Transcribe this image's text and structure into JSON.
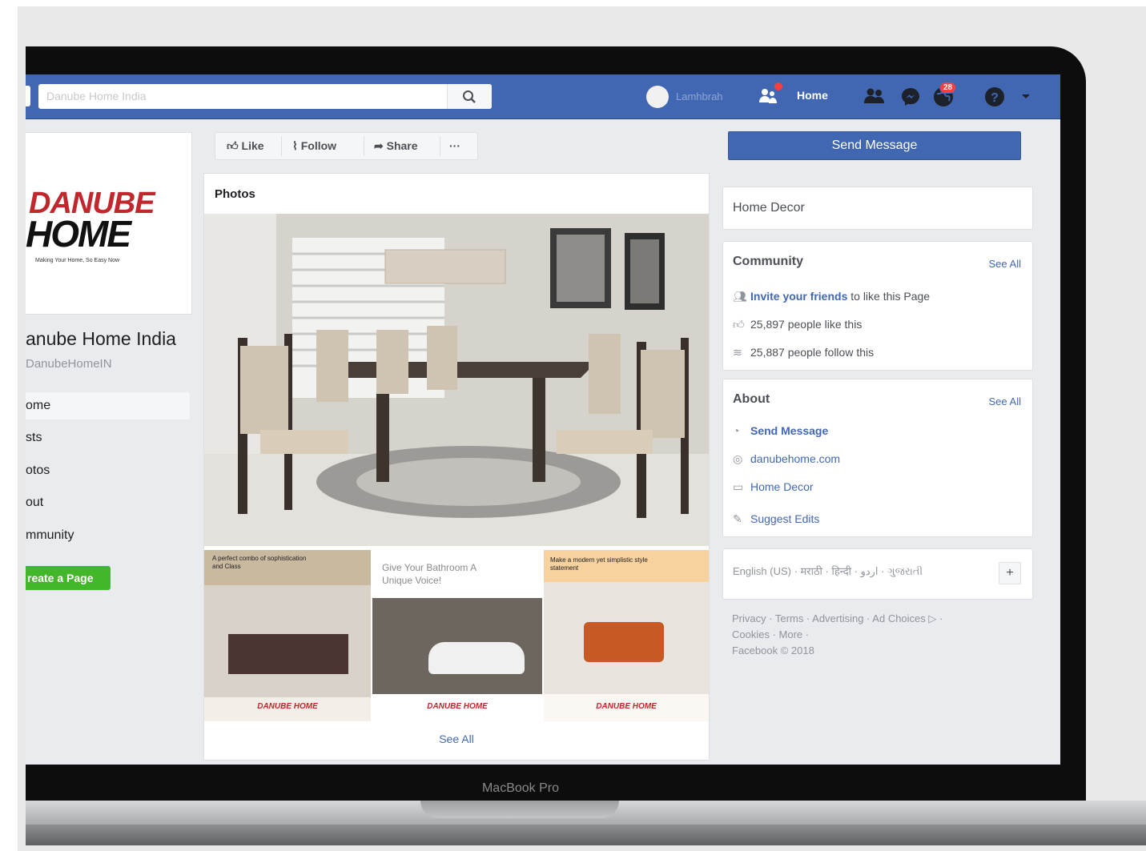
{
  "device": {
    "label": "MacBook Pro"
  },
  "topbar": {
    "search_value": "Danube Home India",
    "user_name": "Lamhbrah",
    "home_label": "Home",
    "notification_count": "28",
    "icons": [
      "search-icon",
      "friend-request-icon",
      "friends-icon",
      "messenger-icon",
      "globe-icon",
      "help-icon",
      "caret-down-icon"
    ]
  },
  "left": {
    "logo_line1": "DANUBE",
    "logo_line2": "HOME",
    "logo_tagline": "Making Your Home, So Easy Now",
    "page_name": "anube Home India",
    "page_username": "DanubeHomeIN",
    "nav": [
      "ome",
      "sts",
      "otos",
      "out",
      "mmunity"
    ],
    "create_page": "reate a Page"
  },
  "center": {
    "actions": {
      "like": "Like",
      "follow": "Follow",
      "share": "Share",
      "more": "···"
    },
    "photos_title": "Photos",
    "thumbs": [
      {
        "caption": "A perfect combo of sophistication and Class",
        "brand": "DANUBE HOME"
      },
      {
        "caption": "Give Your Bathroom A Unique Voice!",
        "brand": "DANUBE HOME"
      },
      {
        "caption": "Make a modern yet simplistic style statement",
        "brand": "DANUBE HOME"
      }
    ],
    "see_all": "See All"
  },
  "right": {
    "send_message": "Send Message",
    "category": "Home Decor",
    "community": {
      "title": "Community",
      "see_all": "See All",
      "invite_link": "Invite your friends",
      "invite_rest": " to like this Page",
      "likes": "25,897 people like this",
      "follows": "25,887 people follow this"
    },
    "about": {
      "title": "About",
      "see_all": "See All",
      "send_message": "Send Message",
      "website": "danubehome.com",
      "category": "Home Decor",
      "suggest": "Suggest Edits"
    },
    "languages": "English (US) · मराठी · हिन्दी · اردو · ગુજરાતી",
    "footer_line1": "Privacy · Terms · Advertising · Ad Choices ▷ ·",
    "footer_line2": "Cookies · More ·",
    "footer_line3": "Facebook © 2018"
  },
  "colors": {
    "fb_blue": "#4267b2",
    "green": "#42b72a",
    "red": "#c1272d",
    "notif_red": "#fa3e3e"
  }
}
